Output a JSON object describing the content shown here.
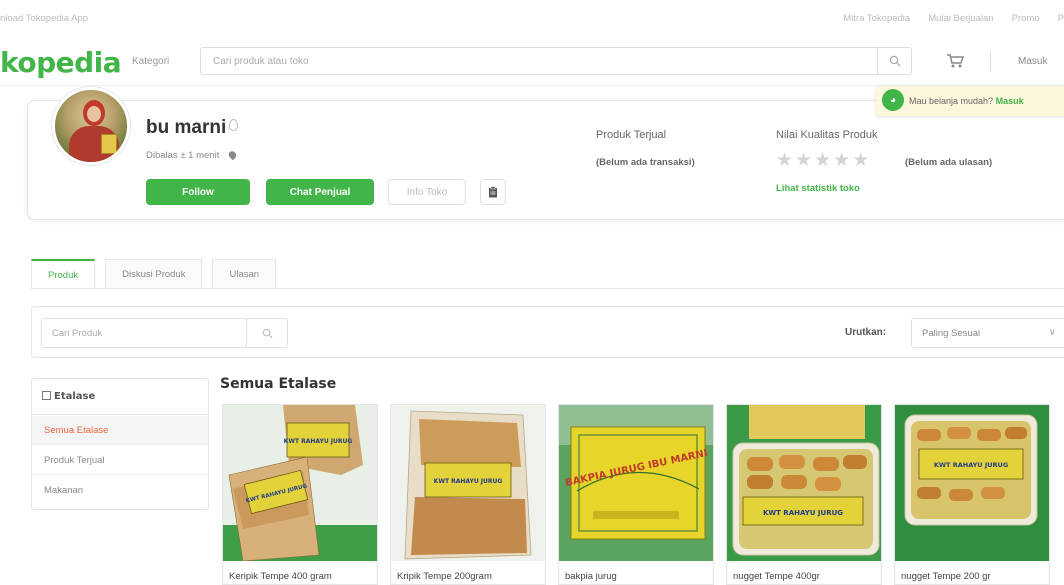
{
  "topstrip": {
    "left": "nload Tokopedia App",
    "right": [
      "Mitra Tokopedia",
      "Mulai Berjualan",
      "Promo",
      "P"
    ]
  },
  "header": {
    "logo": "kopedia",
    "kategori": "Kategori",
    "search_placeholder": "Cari produk atau toko",
    "masuk": "Masuk"
  },
  "tooltip": {
    "text": "Mau belanja mudah?",
    "link": "Masuk"
  },
  "shop": {
    "name": "bu marni",
    "last_seen": "Dibalas ± 1 menit",
    "follow": "Follow",
    "chat": "Chat Penjual",
    "info": "Info Toko",
    "sold_label": "Produk Terjual",
    "sold_value": "(Belum ada transaksi)",
    "quality_label": "Nilai Kualitas Produk",
    "quality_value": "(Belum ada ulasan)",
    "rating": 0,
    "stats_link": "Lihat statistik toko"
  },
  "tabs": [
    {
      "label": "Produk",
      "active": true
    },
    {
      "label": "Diskusi Produk",
      "active": false
    },
    {
      "label": "Ulasan",
      "active": false
    }
  ],
  "filter": {
    "search_placeholder": "Cari Produk",
    "sort_label": "Urutkan:",
    "sort_value": "Paling Sesuai"
  },
  "etalase": {
    "title": "Etalase",
    "items": [
      {
        "label": "Semua Etalase",
        "active": true
      },
      {
        "label": "Produk Terjual",
        "active": false
      },
      {
        "label": "Makanan",
        "active": false
      }
    ]
  },
  "section_title": "Semua Etalase",
  "products": [
    {
      "name": "Keripik Tempe 400 gram",
      "label": "KWT RAHAYU JURUG"
    },
    {
      "name": "Kripik Tempe 200gram",
      "label": "KWT RAHAYU JURUG"
    },
    {
      "name": "bakpia jurug",
      "label": "BAKPIA JURUG IBU MARNI"
    },
    {
      "name": "nugget Tempe 400gr",
      "label": "KWT RAHAYU JURUG"
    },
    {
      "name": "nugget Tempe 200 gr",
      "label": "KWT RAHAYU JURUG"
    }
  ],
  "colors": {
    "brand_green": "#42b549",
    "active_orange": "#e8643d"
  }
}
